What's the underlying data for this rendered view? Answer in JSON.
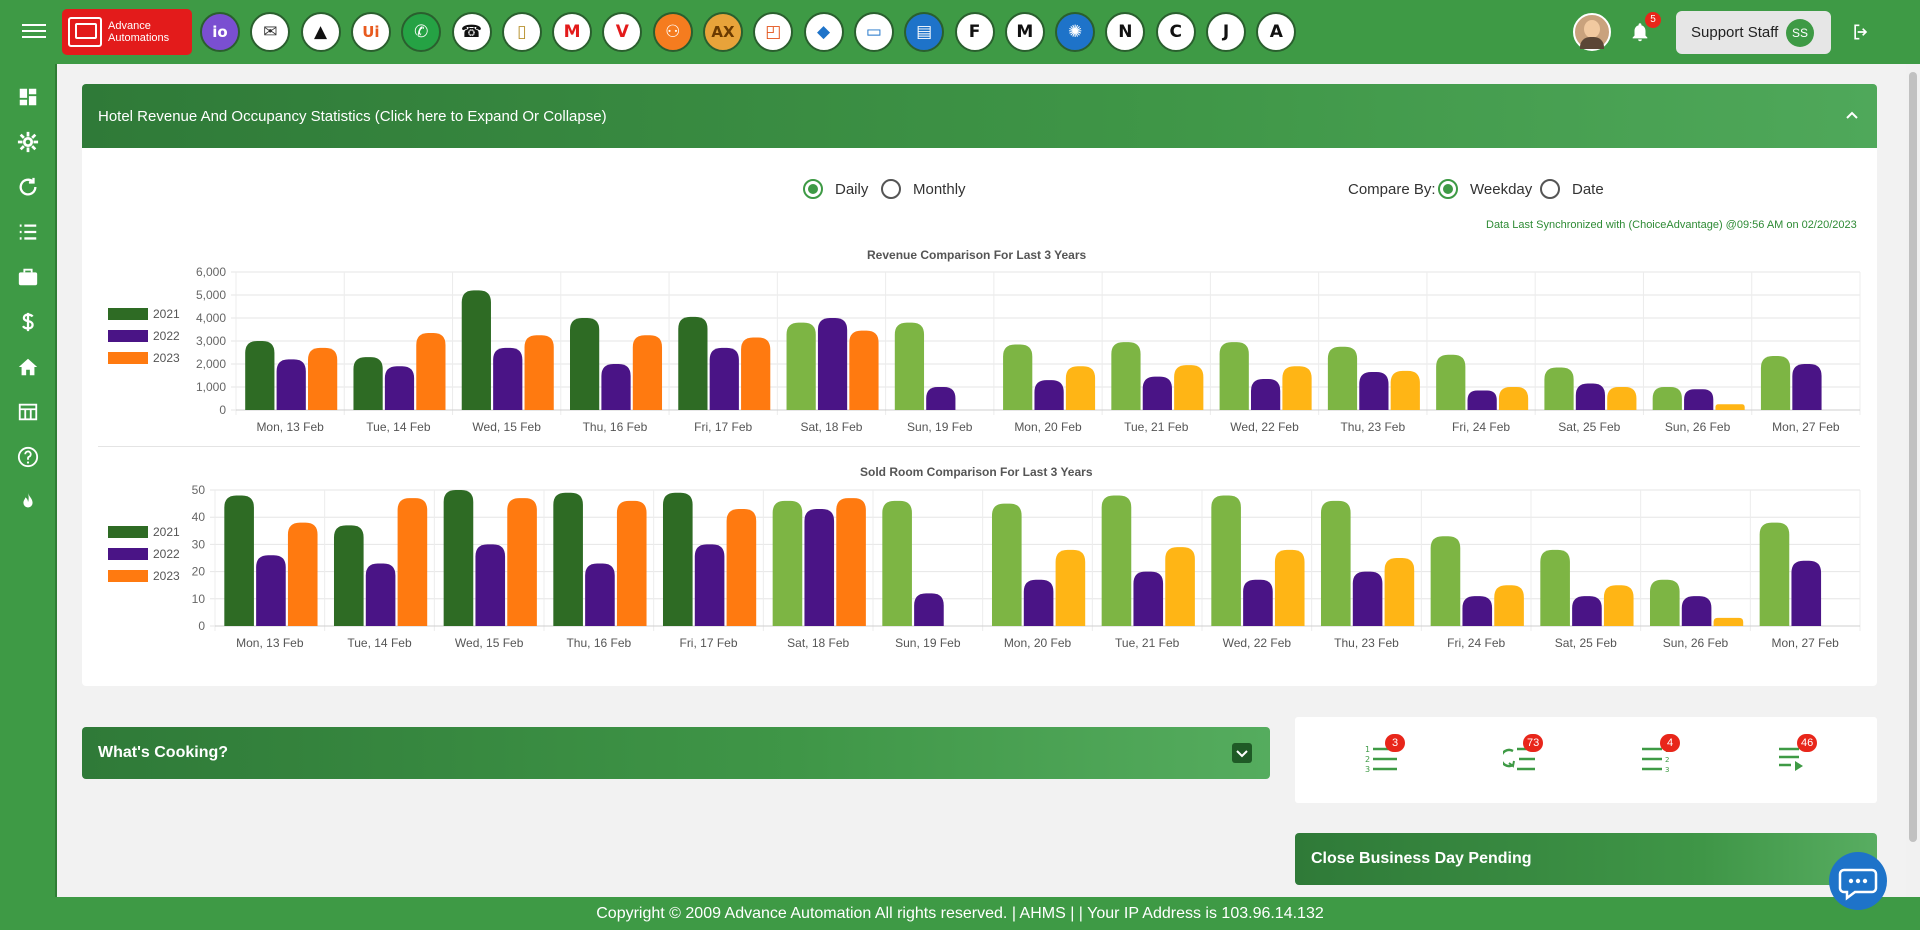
{
  "brand": {
    "line1": "Advance",
    "line2": "Automations",
    "color": "#e31b1b"
  },
  "app_icons": [
    {
      "name": "io-icon",
      "label": "io",
      "bg": "#7a4fd1",
      "fg": "#ffffff"
    },
    {
      "name": "mail-icon",
      "label": "✉",
      "bg": "#ffffff",
      "fg": "#333333"
    },
    {
      "name": "triangle-icon",
      "label": "▲",
      "bg": "#ffffff",
      "fg": "#111111"
    },
    {
      "name": "ui-icon",
      "label": "Ui",
      "bg": "#ffffff",
      "fg": "#e85a1e"
    },
    {
      "name": "whatsapp-icon",
      "label": "✆",
      "bg": "#25a244",
      "fg": "#ffffff"
    },
    {
      "name": "phone-icon",
      "label": "☎",
      "bg": "#ffffff",
      "fg": "#111111"
    },
    {
      "name": "tower-icon",
      "label": "▯",
      "bg": "#ffffff",
      "fg": "#b8912f"
    },
    {
      "name": "m-red-icon",
      "label": "M",
      "bg": "#ffffff",
      "fg": "#e31b1b"
    },
    {
      "name": "v-red-icon",
      "label": "V",
      "bg": "#ffffff",
      "fg": "#e31b1b"
    },
    {
      "name": "client-icon",
      "label": "⚇",
      "bg": "#f57c1f",
      "fg": "#ffffff"
    },
    {
      "name": "ax-icon",
      "label": "AX",
      "bg": "#e8a33a",
      "fg": "#6b3a00"
    },
    {
      "name": "office-icon",
      "label": "◰",
      "bg": "#ffffff",
      "fg": "#e4531a"
    },
    {
      "name": "diamond-icon",
      "label": "◆",
      "bg": "#ffffff",
      "fg": "#1e73c9"
    },
    {
      "name": "hotel-bed-icon",
      "label": "▭",
      "bg": "#ffffff",
      "fg": "#1e73c9"
    },
    {
      "name": "message-icon",
      "label": "▤",
      "bg": "#1e73c9",
      "fg": "#ffffff"
    },
    {
      "name": "f-letter-icon",
      "label": "F",
      "bg": "#ffffff",
      "fg": "#111111"
    },
    {
      "name": "m-letter-icon",
      "label": "M",
      "bg": "#ffffff",
      "fg": "#111111"
    },
    {
      "name": "lifebuoy-icon",
      "label": "✺",
      "bg": "#1e73c9",
      "fg": "#ffffff"
    },
    {
      "name": "n-letter-icon",
      "label": "N",
      "bg": "#ffffff",
      "fg": "#111111"
    },
    {
      "name": "c-letter-icon",
      "label": "C",
      "bg": "#ffffff",
      "fg": "#111111"
    },
    {
      "name": "j-letter-icon",
      "label": "J",
      "bg": "#ffffff",
      "fg": "#111111"
    },
    {
      "name": "a-letter-icon",
      "label": "A",
      "bg": "#ffffff",
      "fg": "#111111"
    }
  ],
  "header": {
    "notification_count": "5",
    "user_label": "Support Staff",
    "user_initials": "SS"
  },
  "sidebar_icons": [
    "dashboard-icon",
    "gear-icon",
    "refresh-icon",
    "list-icon",
    "briefcase-icon",
    "dollar-icon",
    "home-icon",
    "table-icon",
    "help-icon",
    "fire-icon"
  ],
  "stats_panel": {
    "title": "Hotel Revenue And Occupancy Statistics (Click here to Expand Or Collapse)",
    "period_options": [
      "Daily",
      "Monthly"
    ],
    "period_selected": "Daily",
    "compare_label": "Compare By:",
    "compare_options": [
      "Weekday",
      "Date"
    ],
    "compare_selected": "Weekday",
    "sync_text": "Data Last Synchronized with (ChoiceAdvantage) @09:56 AM on 02/20/2023"
  },
  "chart_data": [
    {
      "type": "bar",
      "title": "Revenue Comparison For Last 3 Years",
      "categories": [
        "Mon, 13 Feb",
        "Tue, 14 Feb",
        "Wed, 15 Feb",
        "Thu, 16 Feb",
        "Fri, 17 Feb",
        "Sat, 18 Feb",
        "Sun, 19 Feb",
        "Mon, 20 Feb",
        "Tue, 21 Feb",
        "Wed, 22 Feb",
        "Thu, 23 Feb",
        "Fri, 24 Feb",
        "Sat, 25 Feb",
        "Sun, 26 Feb",
        "Mon, 27 Feb"
      ],
      "ylim": [
        0,
        6000
      ],
      "yticks": [
        "6,000",
        "5,000",
        "4,000",
        "3,000",
        "2,000",
        "1,000",
        "0"
      ],
      "yticks_values": [
        6000,
        5000,
        4000,
        3000,
        2000,
        1000,
        0
      ],
      "legend_position": "left",
      "series": [
        {
          "name": "2021",
          "color": "#2e6b24",
          "colors_after_past": "#7db544",
          "values": [
            3000,
            2300,
            5200,
            4000,
            4050,
            3800,
            3800,
            2850,
            2950,
            2950,
            2750,
            2400,
            1850,
            1000,
            2350
          ]
        },
        {
          "name": "2022",
          "color": "#4a1486",
          "values": [
            2200,
            1900,
            2700,
            2000,
            2700,
            4000,
            1000,
            1300,
            1450,
            1350,
            1650,
            850,
            1150,
            900,
            2000
          ]
        },
        {
          "name": "2023",
          "color": "#ff7a10",
          "colors_after_past": "#ffb515",
          "values": [
            2700,
            3350,
            3250,
            3250,
            3150,
            3450,
            0,
            1900,
            1950,
            1900,
            1700,
            1000,
            1000,
            250,
            null
          ]
        }
      ]
    },
    {
      "type": "bar",
      "title": "Sold Room Comparison For Last 3 Years",
      "categories": [
        "Mon, 13 Feb",
        "Tue, 14 Feb",
        "Wed, 15 Feb",
        "Thu, 16 Feb",
        "Fri, 17 Feb",
        "Sat, 18 Feb",
        "Sun, 19 Feb",
        "Mon, 20 Feb",
        "Tue, 21 Feb",
        "Wed, 22 Feb",
        "Thu, 23 Feb",
        "Fri, 24 Feb",
        "Sat, 25 Feb",
        "Sun, 26 Feb",
        "Mon, 27 Feb"
      ],
      "ylim": [
        0,
        50
      ],
      "yticks": [
        "50",
        "40",
        "30",
        "20",
        "10",
        "0"
      ],
      "yticks_values": [
        50,
        40,
        30,
        20,
        10,
        0
      ],
      "legend_position": "left",
      "series": [
        {
          "name": "2021",
          "color": "#2e6b24",
          "colors_after_past": "#7db544",
          "values": [
            48,
            37,
            50,
            49,
            49,
            46,
            46,
            45,
            48,
            48,
            46,
            33,
            28,
            17,
            38
          ]
        },
        {
          "name": "2022",
          "color": "#4a1486",
          "values": [
            26,
            23,
            30,
            23,
            30,
            43,
            12,
            17,
            20,
            17,
            20,
            11,
            11,
            11,
            24
          ]
        },
        {
          "name": "2023",
          "color": "#ff7a10",
          "colors_after_past": "#ffb515",
          "values": [
            38,
            47,
            47,
            46,
            43,
            47,
            0,
            28,
            29,
            28,
            25,
            15,
            15,
            3,
            null
          ]
        }
      ]
    }
  ],
  "cooking_panel": {
    "title": "What's Cooking?"
  },
  "stats_badges": [
    {
      "name": "ordered-list-icon",
      "count": "3"
    },
    {
      "name": "refresh-list-icon",
      "count": "73"
    },
    {
      "name": "sorted-list-icon",
      "count": "4"
    },
    {
      "name": "playlist-icon",
      "count": "46"
    }
  ],
  "close_day": {
    "title": "Close Business Day Pending"
  },
  "footer": {
    "text": "Copyright © 2009 Advance Automation All rights reserved. | AHMS | | Your IP Address is 103.96.14.132"
  }
}
